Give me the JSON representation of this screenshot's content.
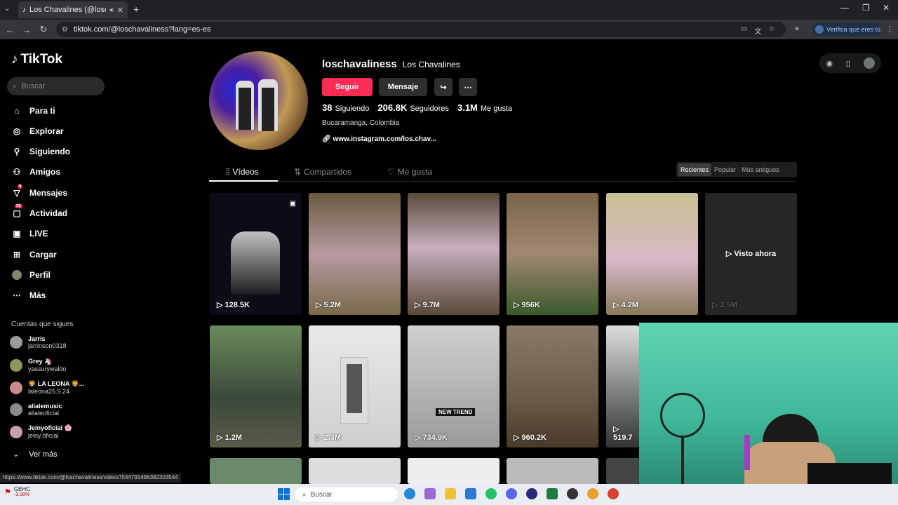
{
  "browser": {
    "tab_title": "Los Chavalines (@loschaval...",
    "url": "tiktok.com/@loschavaliness?lang=es-es",
    "verify_label": "Verifica que eres tú",
    "status_url": "https://www.tiktok.com/@loschavaliness/video/7544791496382303544"
  },
  "sidebar": {
    "logo": "TikTok",
    "search_placeholder": "Buscar",
    "items": [
      {
        "label": "Para ti",
        "icon": "home-icon"
      },
      {
        "label": "Explorar",
        "icon": "compass-icon"
      },
      {
        "label": "Siguiendo",
        "icon": "following-icon"
      },
      {
        "label": "Amigos",
        "icon": "friends-icon"
      },
      {
        "label": "Mensajes",
        "icon": "messages-icon",
        "badge": "5"
      },
      {
        "label": "Actividad",
        "icon": "activity-icon",
        "badge": "36"
      },
      {
        "label": "LIVE",
        "icon": "live-icon"
      },
      {
        "label": "Cargar",
        "icon": "upload-icon"
      },
      {
        "label": "Perfil",
        "icon": "profile-icon"
      },
      {
        "label": "Más",
        "icon": "more-icon"
      }
    ],
    "following_header": "Cuentas que sigues",
    "accounts": [
      {
        "name": "Jarris",
        "user": "jarrinson0318"
      },
      {
        "name": "Grey 🦄",
        "user": "yassurywaldo"
      },
      {
        "name": "🦁 LA LEONA 🦁...",
        "user": "laleona25.9.24"
      },
      {
        "name": "alialemusic",
        "user": "alialeoficial"
      },
      {
        "name": "Jeinyoficial 🌸",
        "user": "jeiny.oficial"
      }
    ],
    "see_more": "Ver más"
  },
  "profile": {
    "username": "loschavaliness",
    "display_name": "Los Chavalines",
    "follow_label": "Seguir",
    "message_label": "Mensaje",
    "following_count": "38",
    "following_label": "Siguiendo",
    "followers_count": "206.8K",
    "followers_label": "Seguidores",
    "likes_count": "3.1M",
    "likes_label": "Me gusta",
    "location": "Bucaramanga, Colombia",
    "link": "www.instagram.com/los.chav..."
  },
  "tabs": [
    "Vídeos",
    "Compartidos",
    "Me gusta"
  ],
  "sort": [
    "Recientes",
    "Popular",
    "Más antiguos"
  ],
  "videos": [
    {
      "views": "128.5K",
      "bg": "#0c0c18"
    },
    {
      "views": "5.2M",
      "bg": "#8a6a45"
    },
    {
      "views": "9.7M",
      "bg": "#6d5a44"
    },
    {
      "views": "956K",
      "bg": "#7a6448"
    },
    {
      "views": "4.2M",
      "bg": "#a49a6a"
    },
    {
      "views": "2.5M",
      "bg": "#2a2a2a",
      "overlay": "Visto ahora"
    },
    {
      "views": "1.2M",
      "bg": "#4a5a3a"
    },
    {
      "views": "2.3M",
      "bg": "#d8d8d8"
    },
    {
      "views": "734.9K",
      "bg": "#bdbdbd",
      "tag": "NEW TREND"
    },
    {
      "views": "960.2K",
      "bg": "#6a5a48"
    },
    {
      "views": "519.7",
      "bg": "#3a3a3a"
    }
  ],
  "taskbar": {
    "search": "Buscar",
    "stock": "GEHC",
    "stock_change": "-3,08%"
  }
}
